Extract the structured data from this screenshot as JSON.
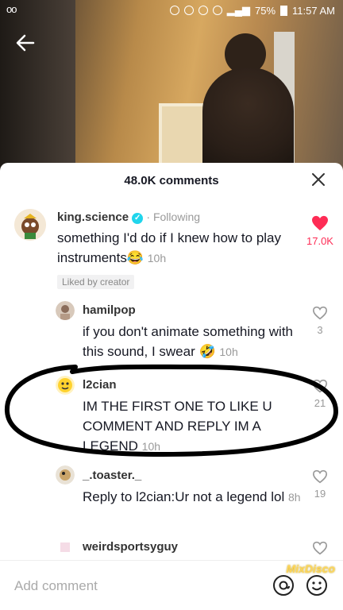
{
  "status_bar": {
    "left": "oo",
    "battery": "75%",
    "time": "11:57 AM"
  },
  "sheet": {
    "title": "48.0K comments"
  },
  "comments": [
    {
      "username": "king.science",
      "following": "Following",
      "text": "something I'd do if I knew how to play instruments😂",
      "time": "10h",
      "likes": "17.0K",
      "badge": "Liked by creator"
    },
    {
      "username": "hamilpop",
      "text": "if you don't animate something with this sound, I swear 🤣",
      "time": "10h",
      "likes": "3"
    },
    {
      "username": "l2cian",
      "text": "IM THE FIRST ONE TO LIKE U COMMENT AND REPLY IM A LEGEND",
      "time": "10h",
      "likes": "21"
    },
    {
      "username": "_.toaster._",
      "reply_prefix": "Reply to ",
      "reply_to": "l2cian",
      "text": ":Ur not a legend lol",
      "time": "8h",
      "likes": "19"
    },
    {
      "username": "weirdsportsyguy"
    }
  ],
  "footer": {
    "placeholder": "Add comment",
    "watermark": "MixDisco"
  },
  "colors": {
    "liked_heart": "#fe2c55",
    "verified": "#20d5ec"
  }
}
